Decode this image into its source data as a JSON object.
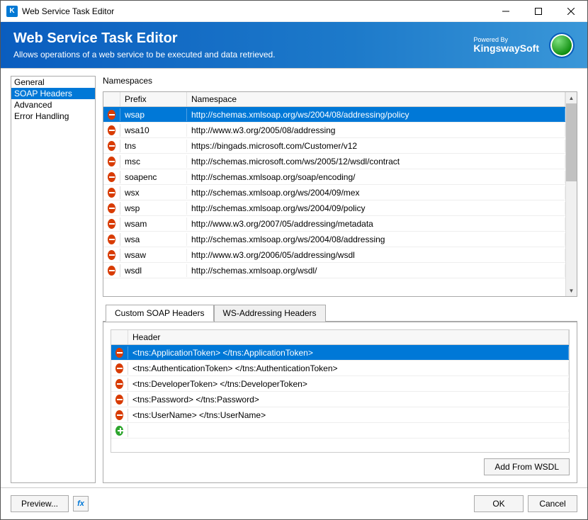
{
  "window": {
    "title": "Web Service Task Editor",
    "icon_letter": "K"
  },
  "header": {
    "title": "Web Service Task Editor",
    "subtitle": "Allows operations of a web service to be executed and data retrieved.",
    "brand_small": "Powered By",
    "brand": "KingswaySoft"
  },
  "sidebar": {
    "items": [
      {
        "label": "General",
        "selected": false
      },
      {
        "label": "SOAP Headers",
        "selected": true
      },
      {
        "label": "Advanced",
        "selected": false
      },
      {
        "label": "Error Handling",
        "selected": false
      }
    ]
  },
  "namespaces": {
    "label": "Namespaces",
    "col_prefix": "Prefix",
    "col_namespace": "Namespace",
    "rows": [
      {
        "prefix": "wsap",
        "ns": "http://schemas.xmlsoap.org/ws/2004/08/addressing/policy",
        "selected": true
      },
      {
        "prefix": "wsa10",
        "ns": "http://www.w3.org/2005/08/addressing"
      },
      {
        "prefix": "tns",
        "ns": "https://bingads.microsoft.com/Customer/v12"
      },
      {
        "prefix": "msc",
        "ns": "http://schemas.microsoft.com/ws/2005/12/wsdl/contract"
      },
      {
        "prefix": "soapenc",
        "ns": "http://schemas.xmlsoap.org/soap/encoding/"
      },
      {
        "prefix": "wsx",
        "ns": "http://schemas.xmlsoap.org/ws/2004/09/mex"
      },
      {
        "prefix": "wsp",
        "ns": "http://schemas.xmlsoap.org/ws/2004/09/policy"
      },
      {
        "prefix": "wsam",
        "ns": "http://www.w3.org/2007/05/addressing/metadata"
      },
      {
        "prefix": "wsa",
        "ns": "http://schemas.xmlsoap.org/ws/2004/08/addressing"
      },
      {
        "prefix": "wsaw",
        "ns": "http://www.w3.org/2006/05/addressing/wsdl"
      },
      {
        "prefix": "wsdl",
        "ns": "http://schemas.xmlsoap.org/wsdl/"
      }
    ]
  },
  "tabs": {
    "custom": "Custom SOAP Headers",
    "ws": "WS-Addressing Headers"
  },
  "headers": {
    "col_header": "Header",
    "rows": [
      {
        "text": "<tns:ApplicationToken> </tns:ApplicationToken>",
        "selected": true
      },
      {
        "text": "<tns:AuthenticationToken> </tns:AuthenticationToken>"
      },
      {
        "text": "<tns:DeveloperToken> </tns:DeveloperToken>"
      },
      {
        "text": "<tns:Password> </tns:Password>"
      },
      {
        "text": "<tns:UserName> </tns:UserName>"
      }
    ],
    "add_from_wsdl": "Add From WSDL"
  },
  "footer": {
    "preview": "Preview...",
    "ok": "OK",
    "cancel": "Cancel"
  }
}
